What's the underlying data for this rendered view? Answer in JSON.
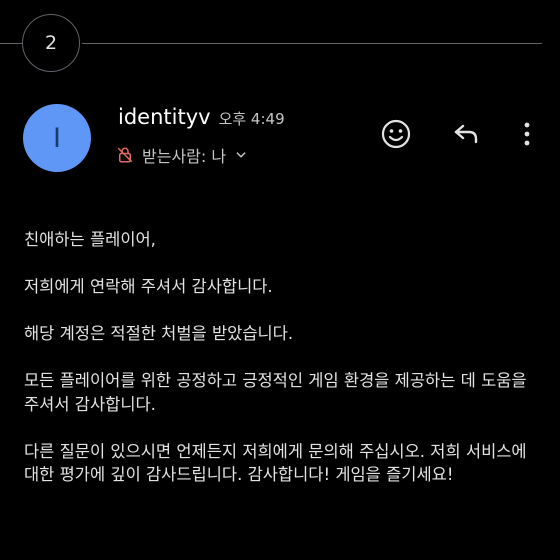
{
  "thread": {
    "collapsed_count": "2"
  },
  "sender": {
    "avatar_initial": "I",
    "avatar_color": "#5e97f6",
    "name": "identityv",
    "time": "오후 4:49"
  },
  "recipient": {
    "label": "받는사람: 나"
  },
  "actions": [
    {
      "icon": "emoji-reaction-icon"
    },
    {
      "icon": "reply-icon"
    },
    {
      "icon": "more-vert-icon"
    }
  ],
  "body": {
    "paragraphs": [
      "친애하는 플레이어,",
      "저희에게 연락해 주셔서 감사합니다.",
      "해당 계정은 적절한 처벌을 받았습니다.",
      "모든 플레이어를 위한 공정하고 긍정적인 게임 환경을 제공하는 데 도움을 주셔서 감사합니다.",
      "다른 질문이 있으시면 언제든지 저희에게 문의해 주십시오. 저희 서비스에 대한 평가에 깊이 감사드립니다. 감사합니다! 게임을 즐기세요!"
    ]
  }
}
